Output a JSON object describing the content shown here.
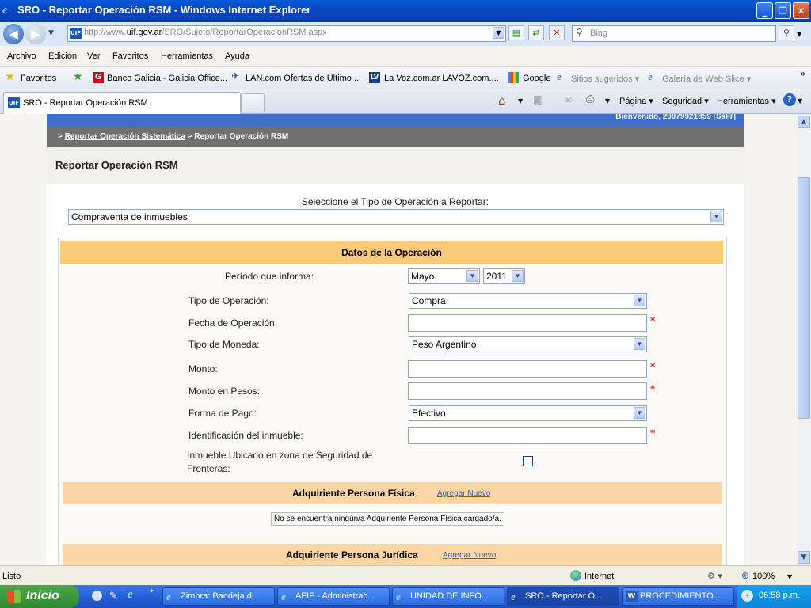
{
  "window": {
    "title": "SRO - Reportar Operación RSM - Windows Internet Explorer"
  },
  "address": {
    "url_prefix": "http://www.",
    "url_domain": "uif.gov.ar",
    "url_path": "/SRO/Sujeto/ReportarOperacionRSM.aspx",
    "search_placeholder": "Bing",
    "site_logo": "UIF"
  },
  "menu": [
    "Archivo",
    "Edición",
    "Ver",
    "Favoritos",
    "Herramientas",
    "Ayuda"
  ],
  "favorites": {
    "label": "Favoritos",
    "items": [
      "Banco Galicia - Galicia Office...",
      "LAN.com Ofertas de Ultimo ...",
      "La Voz.com.ar  LAVOZ.com....",
      "Google",
      "Sitios sugeridos ▾",
      "Galería de Web Slice ▾"
    ],
    "more": "»"
  },
  "tabs": [
    {
      "label": "SRO - Reportar Operación RSM"
    }
  ],
  "commands": [
    "Página ▾",
    "Seguridad ▾",
    "Herramientas ▾"
  ],
  "page": {
    "welcome": "Bienvenido, 20079921859",
    "logout": "[Salir]",
    "crumb_prefix": ">",
    "crumb_link": "Reportar Operación Sistemática",
    "crumb_current": "> Reportar Operación RSM",
    "heading": "Reportar Operación RSM",
    "select_label": "Seleccione el Tipo de Operación a Reportar:",
    "operation_type": "Compraventa de inmuebles",
    "section_datos": "Datos de la Operación",
    "fields": {
      "periodo_label": "Período que informa:",
      "periodo_mes": "Mayo",
      "periodo_anio": "2011",
      "tipo_label": "Tipo de Operación:",
      "tipo_value": "Compra",
      "fecha_label": "Fecha de Operación:",
      "moneda_label": "Tipo de Moneda:",
      "moneda_value": "Peso Argentino",
      "monto_label": "Monto:",
      "monto_pesos_label": "Monto en Pesos:",
      "forma_label": "Forma de Pago:",
      "forma_value": "Efectivo",
      "ident_label": "Identificación del inmueble:",
      "frontera_label_1": "Inmueble Ubicado en zona de Seguridad de",
      "frontera_label_2": "Fronteras:",
      "required_mark": "*"
    },
    "adq_fisica": {
      "title": "Adquiriente Persona Física",
      "link": "Agregar Nuevo",
      "empty": "No se encuentra ningún/a Adquiriente Persona Física cargado/a."
    },
    "adq_juridica": {
      "title": "Adquiriente Persona Jurídica",
      "link": "Agregar Nuevo"
    }
  },
  "status": {
    "left": "Listo",
    "zone": "Internet",
    "zoom": "100%"
  },
  "taskbar": {
    "start": "Inicio",
    "tasks": [
      "Zimbra: Bandeja d...",
      "AFIP - Administrac...",
      "UNIDAD DE INFO...",
      "SRO - Reportar O...",
      "PROCEDIMIENTO..."
    ],
    "clock": "06:58 p.m."
  }
}
